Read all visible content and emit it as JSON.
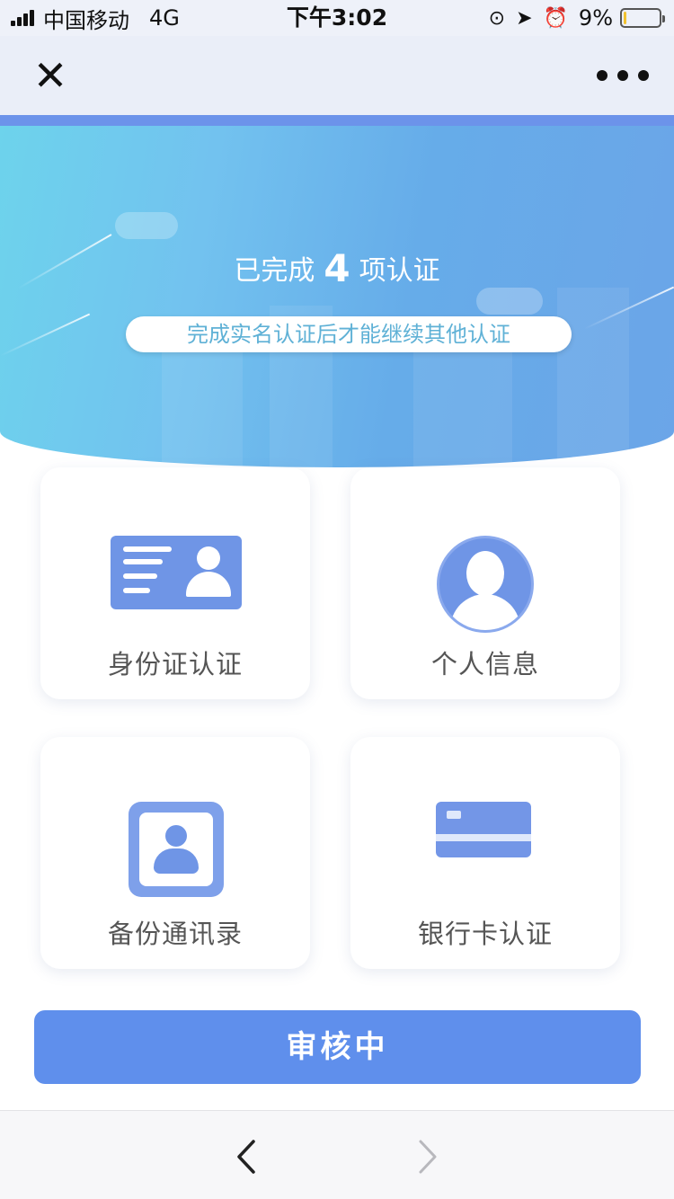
{
  "status_bar": {
    "carrier": "中国移动",
    "network": "4G",
    "time": "下午3:02",
    "battery": "9%",
    "battery_level": 0.09
  },
  "nav": {
    "close_icon": "close-icon",
    "more_icon": "more-icon"
  },
  "banner": {
    "title_prefix": "已完成",
    "completed_count": "4",
    "title_suffix": "项认证",
    "notice": "完成实名认证后才能继续其他认证"
  },
  "cards": [
    {
      "label": "身份证认证",
      "icon": "id-card-icon"
    },
    {
      "label": "个人信息",
      "icon": "person-icon"
    },
    {
      "label": "备份通讯录",
      "icon": "contacts-icon"
    },
    {
      "label": "银行卡认证",
      "icon": "bank-card-icon"
    }
  ],
  "primary_button": {
    "label": "审核中"
  },
  "colors": {
    "accent": "#5f8fec",
    "icon_blue": "#6f95e6",
    "banner_cyan": "#6dd3ec",
    "banner_blue": "#66ace9"
  }
}
